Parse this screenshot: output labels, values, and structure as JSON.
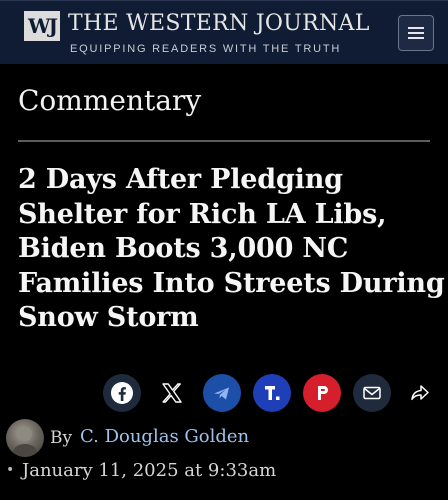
{
  "header": {
    "logo_text": "WJ",
    "brand": "THE WESTERN JOURNAL",
    "tagline": "EQUIPPING READERS WITH THE TRUTH",
    "menu_icon": "hamburger-menu-icon",
    "background": "#101c33"
  },
  "article": {
    "section": "Commentary",
    "headline_lines": [
      "2 Days After Pledging",
      "Shelter for Rich LA Libs,",
      "Biden Boots 3,000 NC",
      "Families Into Streets During",
      "Snow Storm"
    ],
    "author_prefix": "By",
    "author": "C. Douglas Golden",
    "author_color": "#9ec3ec",
    "bullet": "•",
    "date": "January 11, 2025 at 9:33am"
  },
  "share": [
    {
      "name": "facebook-share-button",
      "icon": "facebook-icon",
      "color": "#1f2a3d"
    },
    {
      "name": "x-share-button",
      "icon": "x-logo-icon",
      "color": "#000000"
    },
    {
      "name": "telegram-share-button",
      "icon": "paper-plane-icon",
      "color": "#1d4fa8"
    },
    {
      "name": "truth-social-share-button",
      "icon": "truth-social-icon",
      "color": "#1f3fb8"
    },
    {
      "name": "parler-share-button",
      "icon": "parler-icon",
      "color": "#d61f2c"
    },
    {
      "name": "email-share-button",
      "icon": "envelope-icon",
      "color": "#1f2a3d"
    },
    {
      "name": "more-share-button",
      "icon": "share-arrow-icon",
      "color": "#000000"
    }
  ]
}
